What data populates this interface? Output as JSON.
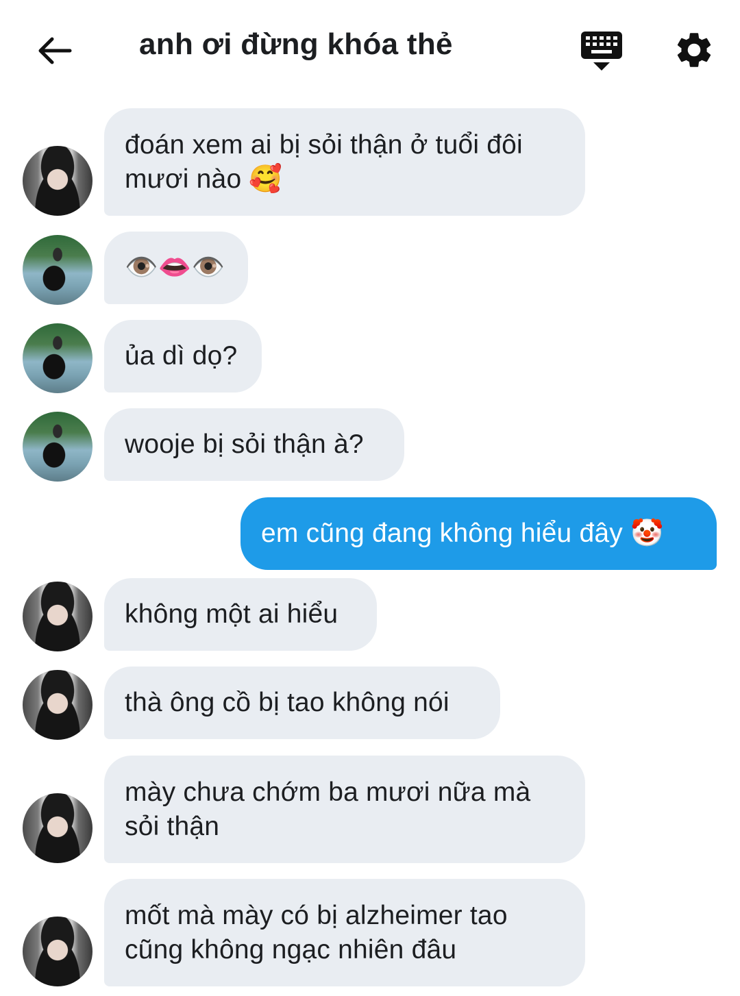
{
  "header": {
    "title": "anh ơi đừng khóa thẻ",
    "back_icon": "arrow-left-icon",
    "keyboard_icon": "keyboard-icon",
    "settings_icon": "gear-icon"
  },
  "colors": {
    "incoming_bubble": "#e9edf2",
    "outgoing_bubble": "#1e9be8",
    "text": "#1c1e21"
  },
  "messages": [
    {
      "direction": "in",
      "avatar": "avatar-a",
      "lines": [
        "đoán xem ai bị sỏi thận ở tuổi đôi",
        "mươi nào 🥰"
      ]
    },
    {
      "direction": "in",
      "avatar": "avatar-b",
      "lines": [
        "👁️👄👁️"
      ]
    },
    {
      "direction": "in",
      "avatar": "avatar-b",
      "lines": [
        "ủa dì dọ?"
      ]
    },
    {
      "direction": "in",
      "avatar": "avatar-b",
      "lines": [
        "wooje bị sỏi thận à?"
      ]
    },
    {
      "direction": "out",
      "lines": [
        "em cũng đang không hiểu đây 🤡"
      ]
    },
    {
      "direction": "in",
      "avatar": "avatar-a",
      "lines": [
        "không một ai hiểu"
      ]
    },
    {
      "direction": "in",
      "avatar": "avatar-a",
      "lines": [
        "thà ông cồ bị tao không nói"
      ]
    },
    {
      "direction": "in",
      "avatar": "avatar-a",
      "lines": [
        "mày chưa chớm ba mươi nữa mà",
        "sỏi thận"
      ]
    },
    {
      "direction": "in",
      "avatar": "avatar-a",
      "lines": [
        "mốt mà mày có bị alzheimer tao",
        "cũng không ngạc nhiên đâu"
      ]
    }
  ]
}
